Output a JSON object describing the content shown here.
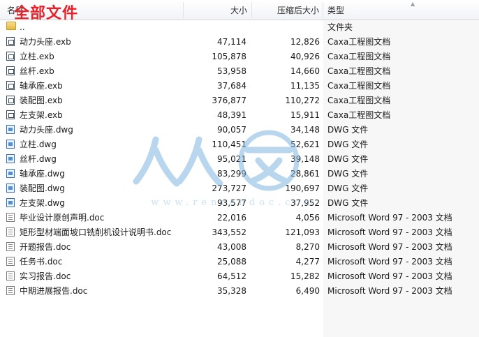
{
  "overlay_title": "全部文件",
  "header": {
    "name": "名称",
    "size": "大小",
    "compressed": "压缩后大小",
    "type": "类型"
  },
  "rows": [
    {
      "icon": "folder-icon",
      "name": "..",
      "size": "",
      "compressed": "",
      "type": "文件夹"
    },
    {
      "icon": "exb-icon",
      "name": "动力头座.exb",
      "size": "47,114",
      "compressed": "12,826",
      "type": "Caxa工程图文档"
    },
    {
      "icon": "exb-icon",
      "name": "立柱.exb",
      "size": "105,878",
      "compressed": "40,926",
      "type": "Caxa工程图文档"
    },
    {
      "icon": "exb-icon",
      "name": "丝杆.exb",
      "size": "53,958",
      "compressed": "14,660",
      "type": "Caxa工程图文档"
    },
    {
      "icon": "exb-icon",
      "name": "轴承座.exb",
      "size": "37,684",
      "compressed": "11,135",
      "type": "Caxa工程图文档"
    },
    {
      "icon": "exb-icon",
      "name": "装配图.exb",
      "size": "376,877",
      "compressed": "110,272",
      "type": "Caxa工程图文档"
    },
    {
      "icon": "exb-icon",
      "name": "左支架.exb",
      "size": "48,391",
      "compressed": "15,911",
      "type": "Caxa工程图文档"
    },
    {
      "icon": "dwg-icon",
      "name": "动力头座.dwg",
      "size": "90,057",
      "compressed": "34,148",
      "type": "DWG 文件"
    },
    {
      "icon": "dwg-icon",
      "name": "立柱.dwg",
      "size": "110,451",
      "compressed": "52,621",
      "type": "DWG 文件"
    },
    {
      "icon": "dwg-icon",
      "name": "丝杆.dwg",
      "size": "95,021",
      "compressed": "39,148",
      "type": "DWG 文件"
    },
    {
      "icon": "dwg-icon",
      "name": "轴承座.dwg",
      "size": "83,299",
      "compressed": "28,861",
      "type": "DWG 文件"
    },
    {
      "icon": "dwg-icon",
      "name": "装配图.dwg",
      "size": "273,727",
      "compressed": "190,697",
      "type": "DWG 文件"
    },
    {
      "icon": "dwg-icon",
      "name": "左支架.dwg",
      "size": "93,577",
      "compressed": "37,952",
      "type": "DWG 文件"
    },
    {
      "icon": "doc-icon",
      "name": "毕业设计原创声明.doc",
      "size": "22,016",
      "compressed": "4,056",
      "type": "Microsoft Word 97 - 2003 文档"
    },
    {
      "icon": "doc-icon",
      "name": "矩形型材端面坡口铣削机设计说明书.doc",
      "size": "343,552",
      "compressed": "121,093",
      "type": "Microsoft Word 97 - 2003 文档"
    },
    {
      "icon": "doc-icon",
      "name": "开题报告.doc",
      "size": "43,008",
      "compressed": "8,270",
      "type": "Microsoft Word 97 - 2003 文档"
    },
    {
      "icon": "doc-icon",
      "name": "任务书.doc",
      "size": "25,088",
      "compressed": "4,277",
      "type": "Microsoft Word 97 - 2003 文档"
    },
    {
      "icon": "doc-icon",
      "name": "实习报告.doc",
      "size": "64,512",
      "compressed": "15,282",
      "type": "Microsoft Word 97 - 2003 文档"
    },
    {
      "icon": "doc-icon",
      "name": "中期进展报告.doc",
      "size": "35,328",
      "compressed": "6,490",
      "type": "Microsoft Word 97 - 2003 文档"
    }
  ],
  "watermark": {
    "text": "www.renrendoc.com"
  }
}
